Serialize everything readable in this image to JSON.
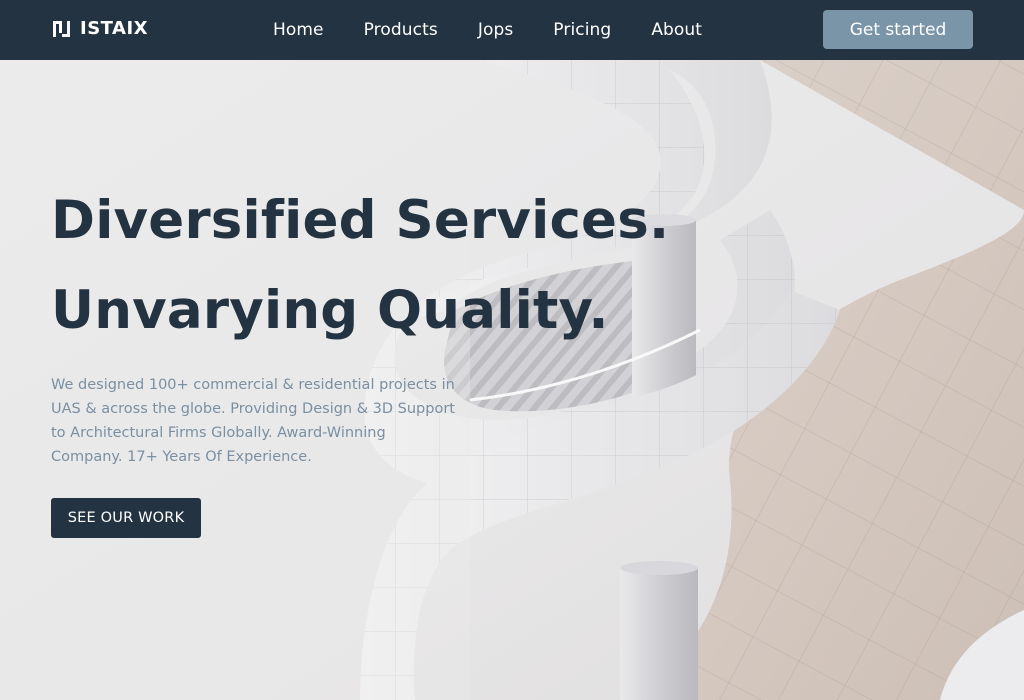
{
  "brand": {
    "name": "ISTAIX",
    "logo_icon": "logo-icon"
  },
  "nav": {
    "items": [
      {
        "label": "Home"
      },
      {
        "label": "Products"
      },
      {
        "label": "Jops"
      },
      {
        "label": "Pricing"
      },
      {
        "label": "About"
      }
    ],
    "cta_label": "Get started"
  },
  "hero": {
    "title_line1": "Diversified Services.",
    "title_line2": "Unvarying Quality.",
    "description": "We designed 100+ commercial & residential projects in UAS & across the globe. Providing Design & 3D Support to Architectural Firms Globally. Award-Winning Company. 17+ Years Of Experience.",
    "button_label": "SEE OUR WORK"
  },
  "colors": {
    "navbar_bg": "#243341",
    "cta_bg": "#7a95a8",
    "title": "#243341",
    "description": "#7b8fa0",
    "hero_button_bg": "#243341"
  }
}
